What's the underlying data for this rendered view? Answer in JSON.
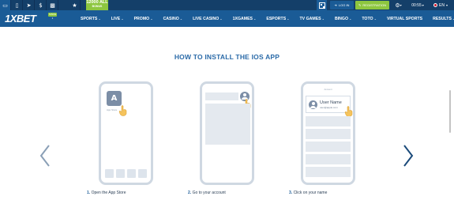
{
  "colors": {
    "topbar": "#143f69",
    "navbar": "#1a5b96",
    "accent_green": "#8dc63f",
    "title_blue": "#2a6aa8",
    "phone_frame": "#cfd8e2",
    "placeholder": "#e4e9ef",
    "icon_grey": "#7c8ea6"
  },
  "topbar": {
    "icons": [
      "desktop-icon",
      "mobile-icon",
      "telegram-icon",
      "dollar-icon",
      "stats-icon",
      "trophy-icon"
    ],
    "promo": {
      "amount": "12000 ALL",
      "label": "BONUS"
    },
    "login_label": "LOG IN",
    "registration_label": "REGISTRATION",
    "time": "00:55",
    "language": "EN"
  },
  "navbar": {
    "logo": "1XBET",
    "logo_badge": "SINCE 1",
    "items": [
      {
        "label": "SPORTS",
        "dropdown": true
      },
      {
        "label": "LIVE",
        "dropdown": true
      },
      {
        "label": "PROMO",
        "dropdown": true
      },
      {
        "label": "CASINO",
        "dropdown": true
      },
      {
        "label": "LIVE CASINO",
        "dropdown": true
      },
      {
        "label": "1XGAMES",
        "dropdown": true
      },
      {
        "label": "ESPORTS",
        "dropdown": true
      },
      {
        "label": "TV GAMES",
        "dropdown": true
      },
      {
        "label": "BINGO",
        "dropdown": true
      },
      {
        "label": "TOTO",
        "dropdown": true
      },
      {
        "label": "VIRTUAL SPORTS",
        "dropdown": false
      },
      {
        "label": "RESULTS",
        "dropdown": true
      }
    ]
  },
  "main": {
    "title": "HOW TO INSTALL THE IOS APP",
    "phone1": {
      "app_label": "App Store"
    },
    "phone3": {
      "header": "Account",
      "user_name": "User Name",
      "user_email": "user@apple.com"
    },
    "steps": [
      {
        "number": "1.",
        "text": "Open the App Store"
      },
      {
        "number": "2.",
        "text": "Go to your account"
      },
      {
        "number": "3.",
        "text": "Click on your name"
      }
    ]
  }
}
